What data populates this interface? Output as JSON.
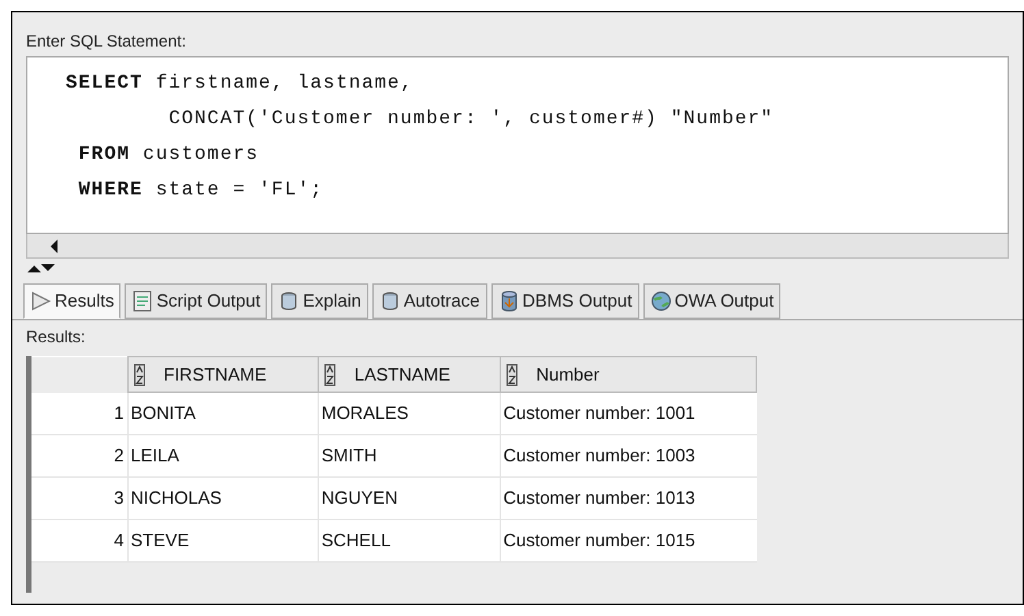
{
  "editor": {
    "label": "Enter SQL Statement:",
    "lines": [
      "**SELECT** firstname, lastname,",
      "        CONCAT('Customer number: ', customer#) \"Number\"",
      " **FROM** customers",
      " **WHERE** state = 'FL';"
    ]
  },
  "tabs": [
    {
      "label": "Results",
      "kind": "play",
      "selected": true
    },
    {
      "label": "Script Output",
      "kind": "script",
      "selected": false
    },
    {
      "label": "Explain",
      "kind": "db",
      "selected": false
    },
    {
      "label": "Autotrace",
      "kind": "db",
      "selected": false
    },
    {
      "label": "DBMS Output",
      "kind": "dbms",
      "selected": false
    },
    {
      "label": "OWA Output",
      "kind": "globe",
      "selected": false
    }
  ],
  "results": {
    "label": "Results:",
    "columns": [
      "",
      "FIRSTNAME",
      "LASTNAME",
      "Number"
    ],
    "rows": [
      [
        "1",
        "BONITA",
        "MORALES",
        "Customer number: 1001"
      ],
      [
        "2",
        "LEILA",
        "SMITH",
        "Customer number: 1003"
      ],
      [
        "3",
        "NICHOLAS",
        "NGUYEN",
        "Customer number: 1013"
      ],
      [
        "4",
        "STEVE",
        "SCHELL",
        "Customer number: 1015"
      ]
    ]
  }
}
